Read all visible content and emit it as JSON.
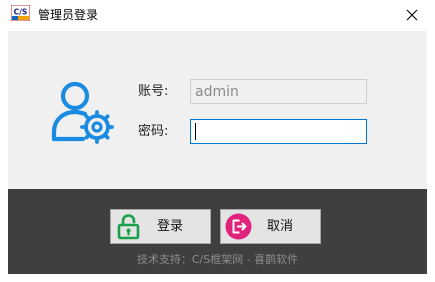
{
  "window": {
    "title": "管理员登录",
    "app_icon_text": "C/S",
    "app_icon": "cs-framework-logo-icon",
    "close_icon": "close-icon"
  },
  "form": {
    "user_icon": "user-gear-icon",
    "account_label": "账号:",
    "account_value": "admin",
    "password_label": "密码:",
    "password_value": ""
  },
  "buttons": {
    "login_label": "登录",
    "login_icon": "lock-icon",
    "cancel_label": "取消",
    "cancel_icon": "logout-icon"
  },
  "footer": {
    "tech_support": "技术支持：C/S框架网 - 喜鹊软件"
  },
  "colors": {
    "accent": "#0078d7",
    "user_icon": "#1a8be0",
    "login_icon": "#1aa04a",
    "cancel_icon": "#e0237d",
    "footer_bg": "#3f3f3f"
  }
}
